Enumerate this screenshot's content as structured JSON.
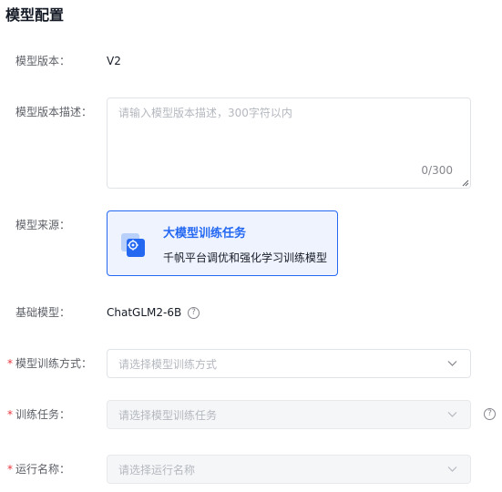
{
  "section": {
    "title": "模型配置"
  },
  "model_version": {
    "label": "模型版本：",
    "value": "V2"
  },
  "model_description": {
    "label": "模型版本描述：",
    "placeholder": "请输入模型版本描述，300字符以内",
    "value": "",
    "counter": "0/300"
  },
  "model_source": {
    "label": "模型来源：",
    "card": {
      "title": "大模型训练任务",
      "description": "千帆平台调优和强化学习训练模型",
      "icon": "model-training-icon",
      "selected": true
    }
  },
  "base_model": {
    "label": "基础模型：",
    "value": "ChatGLM2-6B",
    "help_glyph": "?"
  },
  "training_method": {
    "required_mark": "*",
    "label": "模型训练方式：",
    "placeholder": "请选择模型训练方式",
    "disabled": false
  },
  "training_task": {
    "required_mark": "*",
    "label": "训练任务：",
    "placeholder": "请选择模型训练任务",
    "disabled": true,
    "help_glyph": "?"
  },
  "run_name": {
    "required_mark": "*",
    "label": "运行名称：",
    "placeholder": "请选择运行名称",
    "disabled": true
  },
  "colors": {
    "primary": "#2468f2",
    "required": "#e8353b",
    "card_background": "#eef3fe"
  }
}
